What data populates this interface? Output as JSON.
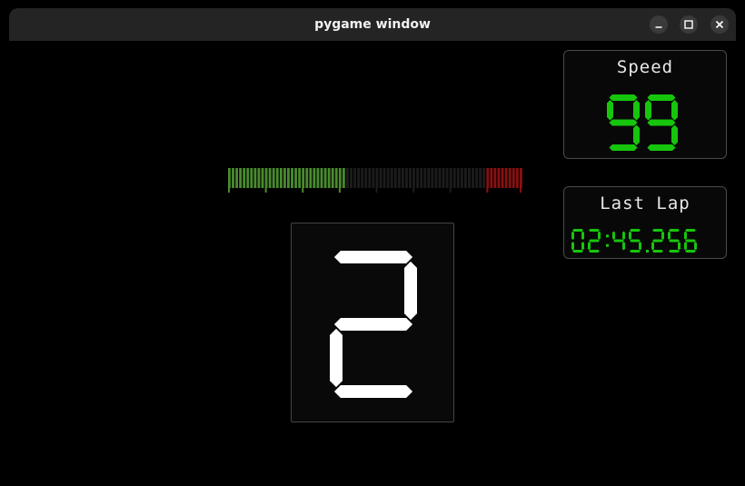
{
  "window": {
    "title": "pygame window"
  },
  "controls": {
    "minimize": "minimize-icon",
    "maximize": "maximize-icon",
    "close": "close-icon"
  },
  "speed": {
    "label": "Speed",
    "value": "99",
    "color": "#16c60c"
  },
  "last_lap": {
    "label": "Last Lap",
    "value": "02:45.256",
    "color": "#16c60c"
  },
  "gear": {
    "value": "2",
    "color": "#ffffff"
  },
  "rpm": {
    "segments": 80,
    "lit": 32,
    "green": "#4a8a2e",
    "dim": "#1c1c1c",
    "red": "#8a1010"
  }
}
